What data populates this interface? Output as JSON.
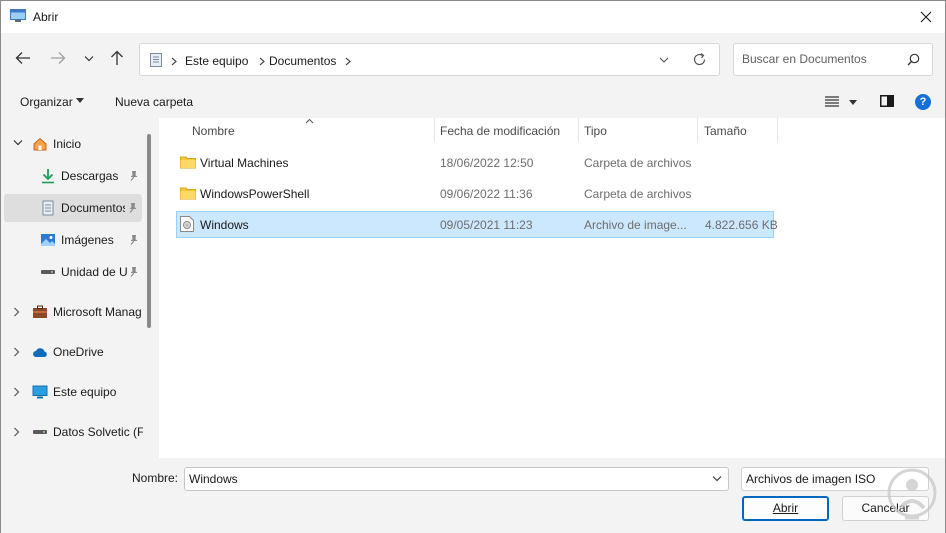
{
  "window": {
    "title": "Abrir",
    "icon": "app-window-icon"
  },
  "nav": {
    "back": "back-arrow-icon",
    "forward": "forward-arrow-icon",
    "recent": "chevron-down-icon",
    "up": "up-arrow-icon",
    "breadcrumb": [
      "Este equipo",
      "Documentos"
    ],
    "search_placeholder": "Buscar en Documentos"
  },
  "toolbar": {
    "organize": "Organizar",
    "new_folder": "Nueva carpeta"
  },
  "sidebar": {
    "items": [
      {
        "label": "Inicio",
        "icon": "home-icon"
      },
      {
        "label": "Descargas",
        "icon": "download-icon",
        "pinned": true
      },
      {
        "label": "Documentos",
        "icon": "documents-icon",
        "pinned": true,
        "selected": true
      },
      {
        "label": "Imágenes",
        "icon": "pictures-icon",
        "pinned": true
      },
      {
        "label": "Unidad de U",
        "icon": "drive-icon",
        "pinned": true
      },
      {
        "label": "Microsoft Manag",
        "icon": "briefcase-icon"
      },
      {
        "label": "OneDrive",
        "icon": "cloud-icon"
      },
      {
        "label": "Este equipo",
        "icon": "computer-icon"
      },
      {
        "label": "Datos Solvetic (F",
        "icon": "drive-icon"
      }
    ]
  },
  "files": {
    "columns": [
      "Nombre",
      "Fecha de modificación",
      "Tipo",
      "Tamaño"
    ],
    "rows": [
      {
        "name": "Virtual Machines",
        "date": "18/06/2022 12:50",
        "type": "Carpeta de archivos",
        "size": "",
        "icon": "folder-icon"
      },
      {
        "name": "WindowsPowerShell",
        "date": "09/06/2022 11:36",
        "type": "Carpeta de archivos",
        "size": "",
        "icon": "folder-icon"
      },
      {
        "name": "Windows",
        "date": "09/05/2021 11:23",
        "type": "Archivo de image...",
        "size": "4.822.656 KB",
        "icon": "disc-image-icon",
        "selected": true
      }
    ]
  },
  "footer": {
    "filename_label": "Nombre:",
    "filename_value": "Windows",
    "filetype": "Archivos de imagen ISO",
    "open": "Abrir",
    "cancel": "Cancelar"
  },
  "colors": {
    "accent": "#0067c0",
    "selection": "#cce8ff",
    "folder": "#f8c543"
  }
}
